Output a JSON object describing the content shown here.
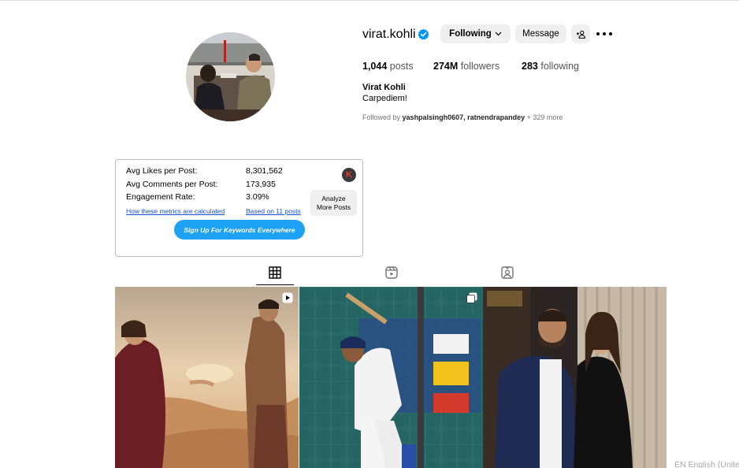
{
  "profile": {
    "username": "virat.kohli",
    "verified_icon": "verified-badge-icon",
    "following_label": "Following",
    "message_label": "Message",
    "posts_count": "1,044",
    "posts_label": "posts",
    "followers_count": "274M",
    "followers_label": "followers",
    "following_count": "283",
    "following_label2": "following",
    "full_name": "Virat Kohli",
    "bio": "Carpediem!",
    "followed_by_prefix": "Followed by",
    "followed_by_users": "yashpalsingh0607, ratnendrapandey",
    "followed_by_more": "+ 329 more"
  },
  "keywords_box": {
    "logo_letter": "K",
    "rows": [
      {
        "label": "Avg Likes per Post:",
        "value": "8,301,562"
      },
      {
        "label": "Avg Comments per Post:",
        "value": "173,935"
      },
      {
        "label": "Engagement Rate:",
        "value": "3.09%"
      }
    ],
    "link_metrics": "How these metrics are calculated",
    "link_based_on": "Based on 11 posts",
    "analyze_label_1": "Analyze",
    "analyze_label_2": "More Posts",
    "signup_label": "Sign Up For Keywords Everywhere"
  },
  "tabs": [
    {
      "icon": "grid-icon",
      "active": true
    },
    {
      "icon": "reels-icon",
      "active": false
    },
    {
      "icon": "tagged-icon",
      "active": false
    }
  ],
  "posts": [
    {
      "badge_icon": "reel-badge-icon"
    },
    {
      "badge_icon": "carousel-badge-icon"
    },
    {
      "badge_icon": ""
    }
  ],
  "footer": {
    "language": "EN English (Unite"
  },
  "colors": {
    "accent_blue": "#1da1f2",
    "link_blue": "#1a4fd8",
    "button_gray": "#efefef"
  }
}
